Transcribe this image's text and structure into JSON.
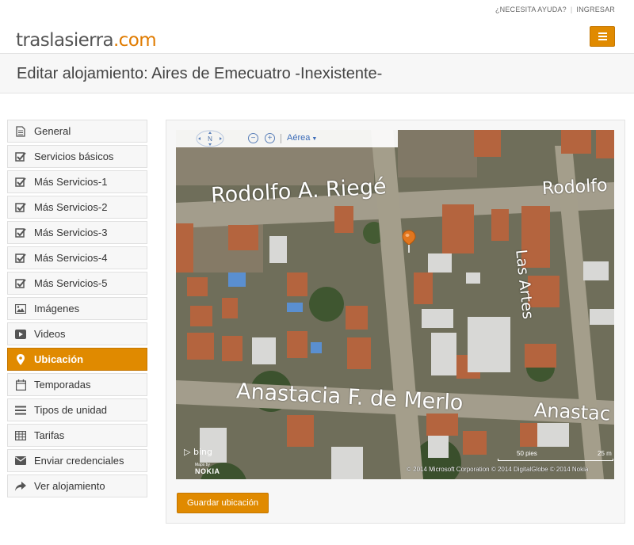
{
  "topbar": {
    "help": "¿NECESITA AYUDA?",
    "login": "INGRESAR"
  },
  "header": {
    "logo_text": "traslasierra",
    "logo_accent": ".com"
  },
  "page": {
    "title": "Editar alojamiento: Aires de Emecuatro -Inexistente-"
  },
  "sidebar": {
    "items": [
      {
        "label": "General",
        "icon": "document-icon"
      },
      {
        "label": "Servicios básicos",
        "icon": "checkbox-icon"
      },
      {
        "label": "Más Servicios-1",
        "icon": "checkbox-icon"
      },
      {
        "label": "Más Servicios-2",
        "icon": "checkbox-icon"
      },
      {
        "label": "Más Servicios-3",
        "icon": "checkbox-icon"
      },
      {
        "label": "Más Servicios-4",
        "icon": "checkbox-icon"
      },
      {
        "label": "Más Servicios-5",
        "icon": "checkbox-icon"
      },
      {
        "label": "Imágenes",
        "icon": "picture-icon"
      },
      {
        "label": "Videos",
        "icon": "play-icon"
      },
      {
        "label": "Ubicación",
        "icon": "map-marker-icon",
        "active": true
      },
      {
        "label": "Temporadas",
        "icon": "calendar-icon"
      },
      {
        "label": "Tipos de unidad",
        "icon": "list-icon"
      },
      {
        "label": "Tarifas",
        "icon": "table-icon"
      },
      {
        "label": "Enviar credenciales",
        "icon": "envelope-icon"
      },
      {
        "label": "Ver alojamiento",
        "icon": "share-icon"
      }
    ]
  },
  "map": {
    "compass_label": "N",
    "zoom_out": "−",
    "zoom_in": "+",
    "view_mode": "Aérea",
    "streets": {
      "rodolfo": "Rodolfo A. Riegé",
      "rodolfo_right": "Rodolfo",
      "las_artes": "Las Artes",
      "anastacia": "Anastacia F. de Merlo",
      "anastacia_right": "Anastac"
    },
    "provider": "bing",
    "maps_by": "Maps by",
    "nokia": "NOKIA",
    "scale_feet": "50 pies",
    "scale_m": "25 m",
    "copyright": "© 2014 Microsoft Corporation   © 2014 DigitalGlobe   © 2014 Nokia"
  },
  "actions": {
    "save_label": "Guardar ubicación"
  },
  "colors": {
    "accent": "#e08a00"
  }
}
